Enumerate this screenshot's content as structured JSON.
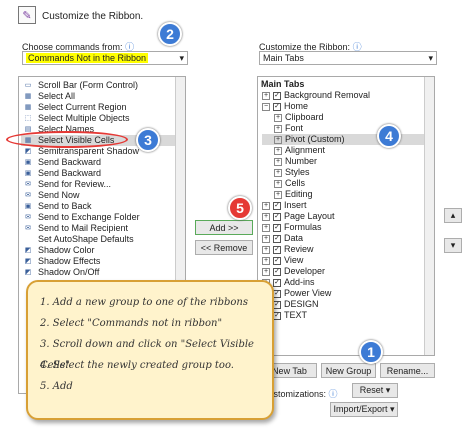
{
  "dialog": {
    "title": "Customize the Ribbon."
  },
  "left": {
    "label": "Choose commands from:",
    "dropdown_value": "Commands Not in the Ribbon",
    "items": [
      {
        "label": "Scroll Bar (Form Control)",
        "icon": "▭"
      },
      {
        "label": "Select All",
        "icon": "▦"
      },
      {
        "label": "Select Current Region",
        "icon": "▦"
      },
      {
        "label": "Select Multiple Objects",
        "icon": "⬚"
      },
      {
        "label": "Select Names",
        "icon": "▤"
      },
      {
        "label": "Select Visible Cells",
        "icon": "▦"
      },
      {
        "label": "Semitransparent Shadow",
        "icon": "◩"
      },
      {
        "label": "Send Backward",
        "icon": "▣"
      },
      {
        "label": "Send Backward",
        "icon": "▣"
      },
      {
        "label": "Send for Review...",
        "icon": "✉"
      },
      {
        "label": "Send Now",
        "icon": "✉"
      },
      {
        "label": "Send to Back",
        "icon": "▣"
      },
      {
        "label": "Send to Exchange Folder",
        "icon": "✉"
      },
      {
        "label": "Send to Mail Recipient",
        "icon": "✉"
      },
      {
        "label": "Set AutoShape Defaults",
        "icon": ""
      },
      {
        "label": "Shadow Color",
        "icon": "◩"
      },
      {
        "label": "Shadow Effects",
        "icon": "◩"
      },
      {
        "label": "Shadow On/Off",
        "icon": "◩"
      }
    ]
  },
  "right": {
    "label": "Customize the Ribbon:",
    "dropdown_value": "Main Tabs",
    "header": "Main Tabs",
    "items": [
      {
        "label": "Background Removal",
        "level": 0,
        "exp": "+",
        "checked": true
      },
      {
        "label": "Home",
        "level": 0,
        "exp": "−",
        "checked": true
      },
      {
        "label": "Clipboard",
        "level": 1,
        "exp": "+",
        "checked": null
      },
      {
        "label": "Font",
        "level": 1,
        "exp": "+",
        "checked": null
      },
      {
        "label": "Pivot (Custom)",
        "level": 1,
        "exp": "+",
        "checked": null
      },
      {
        "label": "Alignment",
        "level": 1,
        "exp": "+",
        "checked": null
      },
      {
        "label": "Number",
        "level": 1,
        "exp": "+",
        "checked": null
      },
      {
        "label": "Styles",
        "level": 1,
        "exp": "+",
        "checked": null
      },
      {
        "label": "Cells",
        "level": 1,
        "exp": "+",
        "checked": null
      },
      {
        "label": "Editing",
        "level": 1,
        "exp": "+",
        "checked": null
      },
      {
        "label": "Insert",
        "level": 0,
        "exp": "+",
        "checked": true
      },
      {
        "label": "Page Layout",
        "level": 0,
        "exp": "+",
        "checked": true
      },
      {
        "label": "Formulas",
        "level": 0,
        "exp": "+",
        "checked": true
      },
      {
        "label": "Data",
        "level": 0,
        "exp": "+",
        "checked": true
      },
      {
        "label": "Review",
        "level": 0,
        "exp": "+",
        "checked": true
      },
      {
        "label": "View",
        "level": 0,
        "exp": "+",
        "checked": true
      },
      {
        "label": "Developer",
        "level": 0,
        "exp": "+",
        "checked": true
      },
      {
        "label": "Add-ins",
        "level": 0,
        "exp": "+",
        "checked": true
      },
      {
        "label": "Power View",
        "level": 0,
        "exp": "+",
        "checked": true
      },
      {
        "label": "DESIGN",
        "level": 0,
        "exp": "+",
        "checked": true
      },
      {
        "label": "TEXT",
        "level": 0,
        "exp": "+",
        "checked": true
      }
    ]
  },
  "buttons": {
    "add": "Add >>",
    "remove": "<< Remove",
    "new_tab": "New Tab",
    "new_group": "New Group",
    "rename": "Rename...",
    "customizations": "Customizations:",
    "reset": "Reset ▾",
    "import_export": "Import/Export ▾",
    "move_up": "▴",
    "move_down": "▾"
  },
  "badges": [
    "1",
    "2",
    "3",
    "4",
    "5"
  ],
  "note": {
    "lines": [
      "1. Add a new group to one of the ribbons",
      "2. Select \"Commands not in ribbon\"",
      "3. Scroll down and click on \"Select Visible Cells\"",
      "4. Select the newly created group too.",
      "5. Add"
    ]
  },
  "colors": {
    "highlight_yellow": "#ffff00",
    "badge_blue": "#3d7bd5",
    "badge_red": "#e53935",
    "note_bg": "#fff3cc",
    "selected_row": "#d9d9d9"
  }
}
